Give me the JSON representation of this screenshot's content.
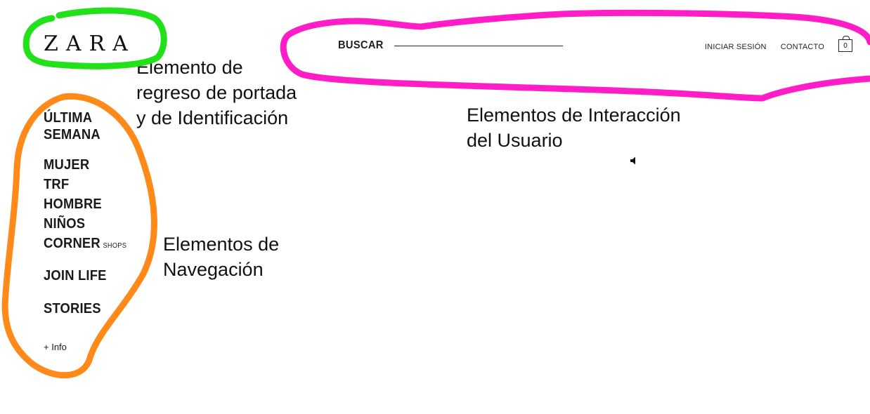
{
  "header": {
    "logo": "ZARA",
    "search_label": "BUSCAR",
    "links": {
      "login": "INICIAR SESIÓN",
      "contact": "CONTACTO"
    },
    "cart_count": "0"
  },
  "nav": {
    "items": [
      "ÚLTIMA",
      "SEMANA",
      "MUJER",
      "TRF",
      "HOMBRE",
      "NIÑOS",
      "CORNER"
    ],
    "corner_suffix": "SHOPS",
    "join_life": "JOIN LIFE",
    "stories": "STORIES",
    "more_info": "+ Info"
  },
  "annotations": {
    "logo_note": [
      "Elemento de",
      "regreso de portada",
      "y de Identificación"
    ],
    "user_note": [
      "Elementos de Interacción",
      "del Usuario"
    ],
    "nav_note": [
      "Elementos de",
      "Navegación"
    ]
  },
  "icons": {
    "speaker": "speaker-icon",
    "cart": "shopping-bag-icon"
  },
  "colors": {
    "logo_circle": "#22e01a",
    "user_circle": "#ff1dc8",
    "nav_circle": "#ff8a1a",
    "text": "#111111",
    "background": "#ffffff"
  }
}
